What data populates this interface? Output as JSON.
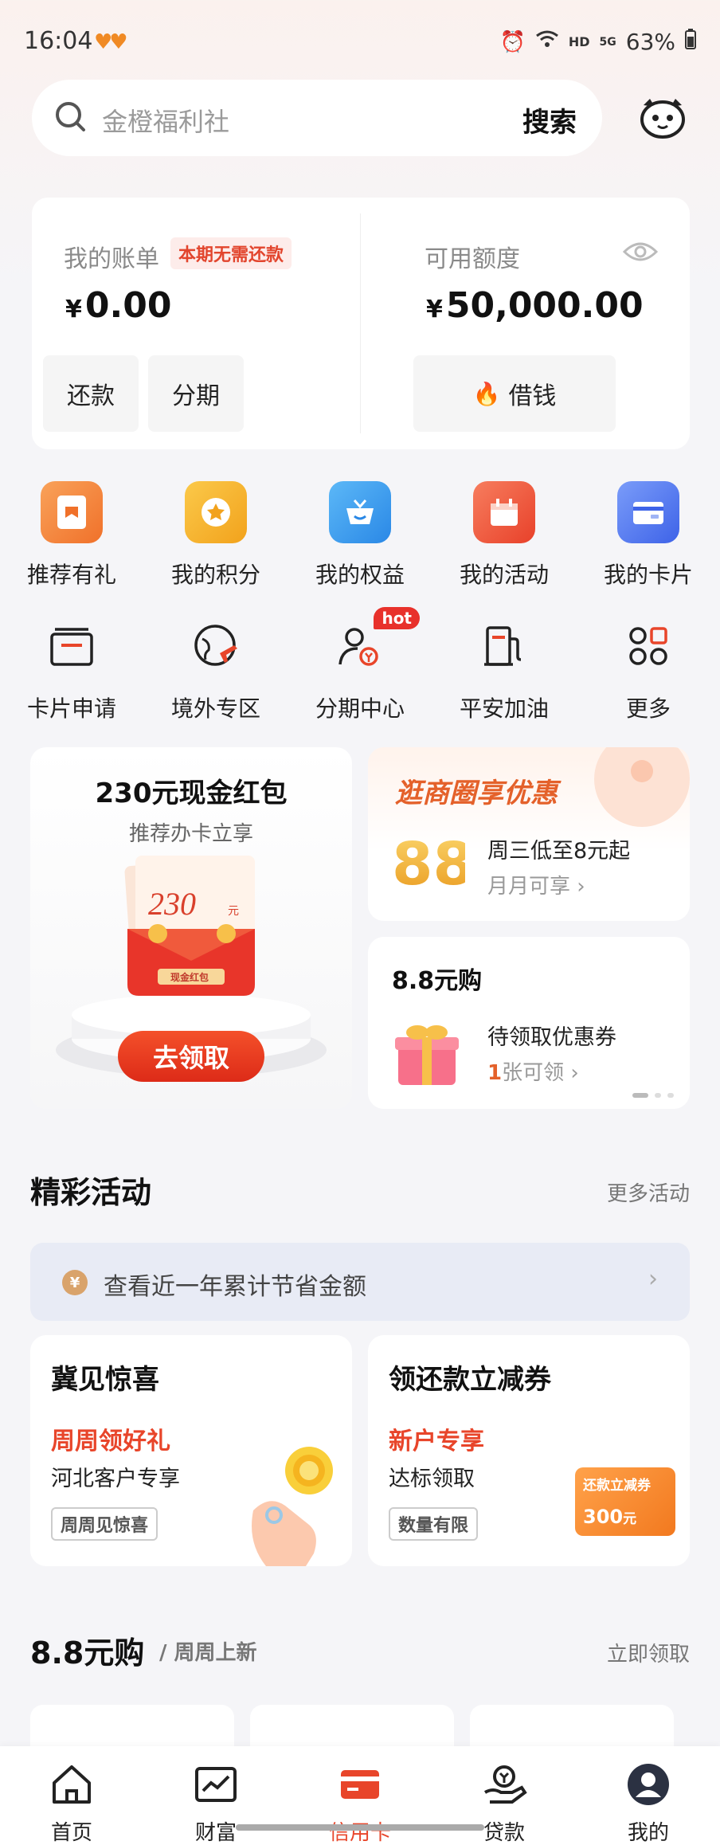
{
  "status": {
    "time": "16:04",
    "battery": "63%",
    "network": "HD",
    "signal": "5G"
  },
  "search": {
    "placeholder": "金橙福利社",
    "button": "搜索"
  },
  "account": {
    "bill_label": "我的账单",
    "bill_badge": "本期无需还款",
    "bill_currency": "¥",
    "bill_amount": "0.00",
    "repay_button": "还款",
    "installment_button": "分期",
    "credit_label": "可用额度",
    "credit_currency": "¥",
    "credit_amount": "50,000.00",
    "borrow_button": "借钱"
  },
  "grid_row1": [
    {
      "label": "推荐有礼",
      "icon": "gift-card-icon",
      "color": "#f5842f"
    },
    {
      "label": "我的积分",
      "icon": "star-coin-icon",
      "color": "#f7b22c"
    },
    {
      "label": "我的权益",
      "icon": "basket-icon",
      "color": "#2f9af0"
    },
    {
      "label": "我的活动",
      "icon": "calendar-gift-icon",
      "color": "#f0573a"
    },
    {
      "label": "我的卡片",
      "icon": "card-icon",
      "color": "#4a78f0"
    }
  ],
  "grid_row2": [
    {
      "label": "卡片申请",
      "icon": "card-apply-icon"
    },
    {
      "label": "境外专区",
      "icon": "globe-plane-icon"
    },
    {
      "label": "分期中心",
      "icon": "installment-user-icon",
      "badge": "hot"
    },
    {
      "label": "平安加油",
      "icon": "fuel-pump-icon"
    },
    {
      "label": "更多",
      "icon": "more-grid-icon"
    }
  ],
  "promo_left": {
    "title": "230元现金红包",
    "subtitle": "推荐办卡立享",
    "cta": "去领取",
    "envelope_amount": "230",
    "envelope_unit": "元",
    "envelope_label": "现金红包"
  },
  "promo_right_top": {
    "title": "逛商圈享优惠",
    "line1": "周三低至8元起",
    "line2": "月月可享",
    "image_text": "88"
  },
  "promo_right_bottom": {
    "title": "8.8元购",
    "line1": "待领取优惠券",
    "count": "1",
    "line2": "张可领"
  },
  "activities": {
    "title": "精彩活动",
    "more": "更多活动",
    "banner": "查看近一年累计节省金额",
    "banner_icon_text": "¥",
    "cards": [
      {
        "title": "冀见惊喜",
        "highlight": "周周领好礼",
        "sub": "河北客户专享",
        "tag": "周周见惊喜"
      },
      {
        "title": "领还款立减券",
        "highlight": "新户专享",
        "sub": "达标领取",
        "tag": "数量有限",
        "coupon_title": "还款立减券",
        "coupon_amount": "300",
        "coupon_unit": "元"
      }
    ]
  },
  "shop": {
    "title": "8.8元购",
    "subtitle": "/ 周周上新",
    "more": "立即领取"
  },
  "tabs": [
    {
      "label": "首页",
      "icon": "home-icon"
    },
    {
      "label": "财富",
      "icon": "wealth-chart-icon"
    },
    {
      "label": "信用卡",
      "icon": "credit-card-icon",
      "active": true
    },
    {
      "label": "贷款",
      "icon": "loan-hand-icon"
    },
    {
      "label": "我的",
      "icon": "profile-icon"
    }
  ],
  "colors": {
    "accent": "#e8452a",
    "brand_orange": "#f5842f"
  }
}
